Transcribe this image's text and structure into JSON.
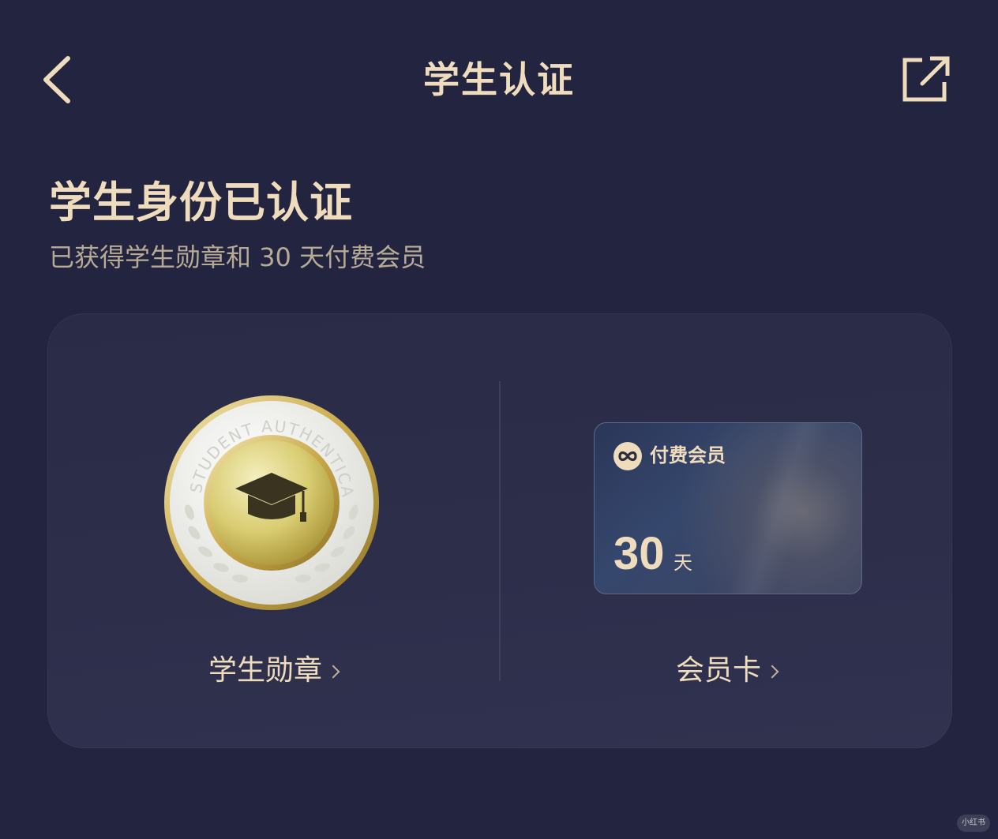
{
  "header": {
    "title": "学生认证",
    "back_icon": "chevron-left-icon",
    "share_icon": "share-external-icon"
  },
  "status": {
    "heading": "学生身份已认证",
    "subtitle": "已获得学生勋章和 30 天付费会员"
  },
  "rewards": {
    "badge": {
      "label": "学生勋章",
      "ring_text": "STUDENT AUTHENTICA",
      "icon": "graduation-cap-icon"
    },
    "membership": {
      "label": "会员卡",
      "card_title": "付费会员",
      "card_days": "30",
      "card_unit": "天",
      "card_icon": "infinity-icon"
    }
  },
  "watermark": "小红书",
  "colors": {
    "background": "#232540",
    "accent_gold": "#efdcbc",
    "muted_text": "#b8ab95",
    "card_bg": "#2c2e4a"
  }
}
